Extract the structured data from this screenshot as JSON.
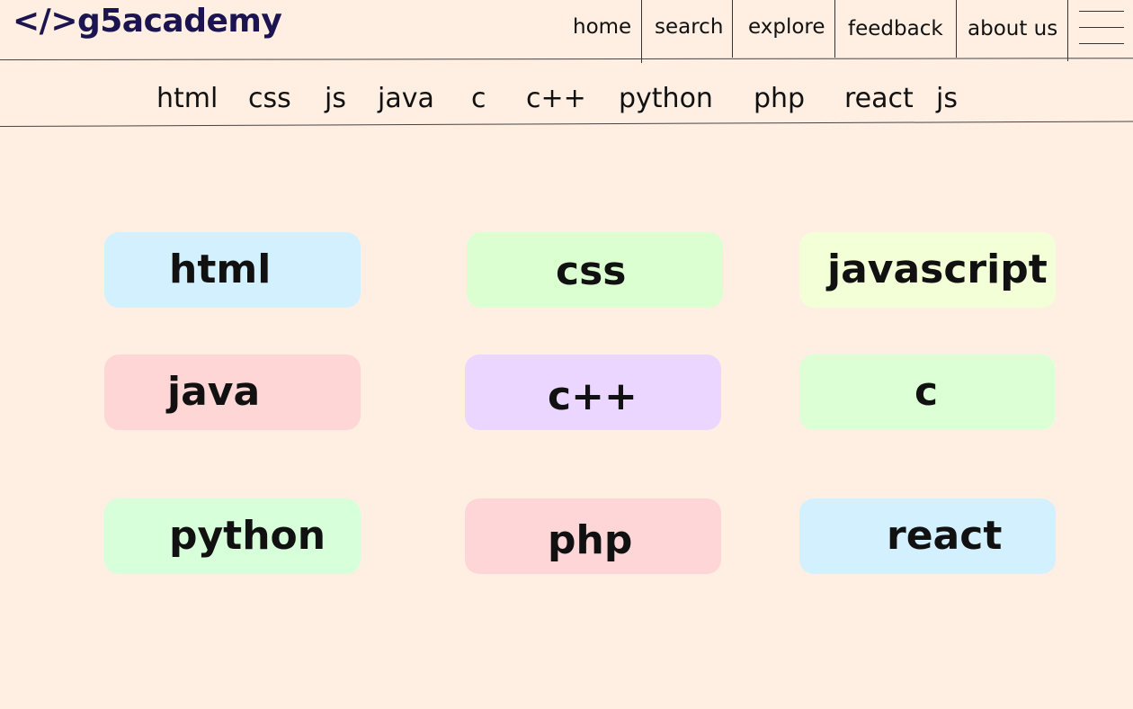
{
  "brand": {
    "logo": "</>g5academy",
    "color": "#1C1450"
  },
  "nav": {
    "items": [
      "home",
      "search",
      "explore",
      "feedback",
      "about us"
    ],
    "menu_icon": "hamburger-menu-icon"
  },
  "subnav": {
    "items": [
      "html",
      "css",
      "js",
      "java",
      "c",
      "c++",
      "python",
      "php",
      "react",
      "js"
    ]
  },
  "cards": [
    {
      "label": "html",
      "color": "#D3F0FF"
    },
    {
      "label": "css",
      "color": "#DCFFD2"
    },
    {
      "label": "javascript",
      "color": "#F3FFD6"
    },
    {
      "label": "java",
      "color": "#FFD6D6"
    },
    {
      "label": "c++",
      "color": "#EAD6FF"
    },
    {
      "label": "c",
      "color": "#DCFFD6"
    },
    {
      "label": "python",
      "color": "#D6FFDA"
    },
    {
      "label": "php",
      "color": "#FFD6D8"
    },
    {
      "label": "react",
      "color": "#D3F0FF"
    }
  ],
  "colors": {
    "background": "#FFEFE3",
    "text": "#111111"
  }
}
